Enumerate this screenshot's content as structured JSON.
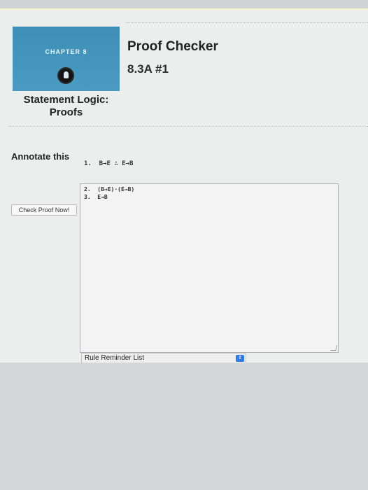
{
  "chapter_card": {
    "chapter_label": "CHAPTER 8",
    "subtitle_line1": "Statement Logic:",
    "subtitle_line2": "Proofs",
    "icon": "lightbulb-icon"
  },
  "header": {
    "title": "Proof Checker",
    "problem_id": "8.3A #1"
  },
  "annotate": {
    "label": "Annotate this",
    "premise_line": "1.  B→E ∴ E→B"
  },
  "proof_lines": [
    "2.  (B→E)·(E→B)",
    "3.  E→B"
  ],
  "actions": {
    "check_button": "Check Proof Now!"
  },
  "rule_reminder": {
    "selected": "Rule Reminder List",
    "icon": "select-arrows-icon"
  }
}
